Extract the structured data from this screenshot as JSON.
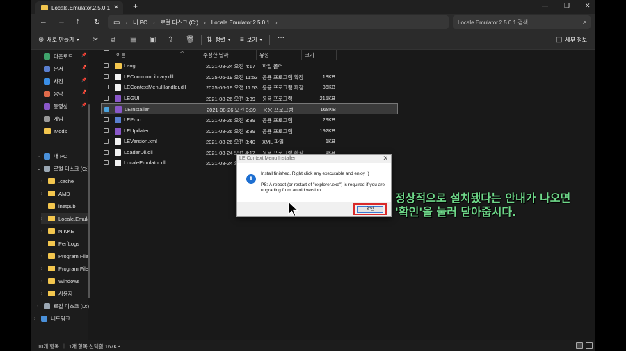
{
  "window": {
    "tab_title": "Locale.Emulator.2.5.0.1",
    "tab_close": "✕",
    "new_tab": "+"
  },
  "nav": {
    "back": "←",
    "forward": "→",
    "up": "↑",
    "refresh": "↻",
    "address": [
      "내 PC",
      "로컬 디스크 (C:)",
      "Locale.Emulator.2.5.0.1"
    ],
    "sep": "›",
    "search_placeholder": "Locale.Emulator.2.5.0.1 검색"
  },
  "toolbar": {
    "new_label": "새로 만들기",
    "sort_label": "정렬",
    "view_label": "보기",
    "more_label": "···",
    "details_label": "세부 정보"
  },
  "sidebar": {
    "quick": [
      {
        "label": "다운로드",
        "icon": "download-icon",
        "color": "#3fa36b"
      },
      {
        "label": "문서",
        "icon": "document-icon",
        "color": "#5a7fd0"
      },
      {
        "label": "사진",
        "icon": "photo-icon",
        "color": "#3a8ee6"
      },
      {
        "label": "음악",
        "icon": "music-icon",
        "color": "#e06a4a"
      },
      {
        "label": "동영상",
        "icon": "video-icon",
        "color": "#8a58c9"
      },
      {
        "label": "게임",
        "icon": "game-icon",
        "color": "#999999"
      },
      {
        "label": "Mods",
        "icon": "folder-icon",
        "color": "#f3c64e"
      }
    ],
    "thispc": "내 PC",
    "drive_c": "로컬 디스크 (C:)",
    "folders": [
      ".cache",
      "AMD",
      "inetpub",
      "Locale.Emulator.2.5.0.1",
      "NIKKE",
      "PerfLogs",
      "Program Files",
      "Program Files (x86)",
      "Windows",
      "사용자"
    ],
    "drive_d": "로컬 디스크 (D:)",
    "network": "네트워크"
  },
  "columns": {
    "name": "이름",
    "date": "수정한 날짜",
    "type": "유형",
    "size": "크기"
  },
  "files": [
    {
      "name": "Lang",
      "date": "2021-08-24 오전 4:17",
      "type": "파일 폴더",
      "size": "",
      "kind": "folder"
    },
    {
      "name": "LECommonLibrary.dll",
      "date": "2025-06-19 오전 11:53",
      "type": "응용 프로그램 확장",
      "size": "18KB",
      "kind": "file"
    },
    {
      "name": "LEContextMenuHandler.dll",
      "date": "2025-06-19 오전 11:53",
      "type": "응용 프로그램 확장",
      "size": "36KB",
      "kind": "file"
    },
    {
      "name": "LEGUI",
      "date": "2021-08-26 오전 3:39",
      "type": "응용 프로그램",
      "size": "215KB",
      "kind": "exe"
    },
    {
      "name": "LEInstaller",
      "date": "2021-08-26 오전 3:39",
      "type": "응용 프로그램",
      "size": "168KB",
      "kind": "exe",
      "selected": true
    },
    {
      "name": "LEProc",
      "date": "2021-08-26 오전 3:39",
      "type": "응용 프로그램",
      "size": "29KB",
      "kind": "blue"
    },
    {
      "name": "LEUpdater",
      "date": "2021-08-26 오전 3:39",
      "type": "응용 프로그램",
      "size": "192KB",
      "kind": "exe"
    },
    {
      "name": "LEVersion.xml",
      "date": "2021-08-26 오전 3:40",
      "type": "XML 파일",
      "size": "1KB",
      "kind": "file"
    },
    {
      "name": "LoaderDll.dll",
      "date": "2021-08-24 오전 4:17",
      "type": "응용 프로그램 확장",
      "size": "1KB",
      "kind": "file"
    },
    {
      "name": "LocaleEmulator.dll",
      "date": "2021-08-24 오전 4:17",
      "type": "응용 프로그램 확장",
      "size": "1KB",
      "kind": "file"
    }
  ],
  "status": {
    "count": "10개 항목",
    "selection": "1개 항목 선택함 167KB"
  },
  "dialog": {
    "title": "LE Context Menu Installer",
    "close": "✕",
    "icon_glyph": "i",
    "message1": "Install finished. Right click any executable and enjoy :)",
    "message2": "PS: A reboot (or restart of \"explorer.exe\") is required if you are upgrading from an old version.",
    "ok": "확인"
  },
  "caption": {
    "line1": "정상적으로 설치됐다는 안내가 나오면",
    "line2": "'확인'을 눌러 닫아줍시다."
  }
}
